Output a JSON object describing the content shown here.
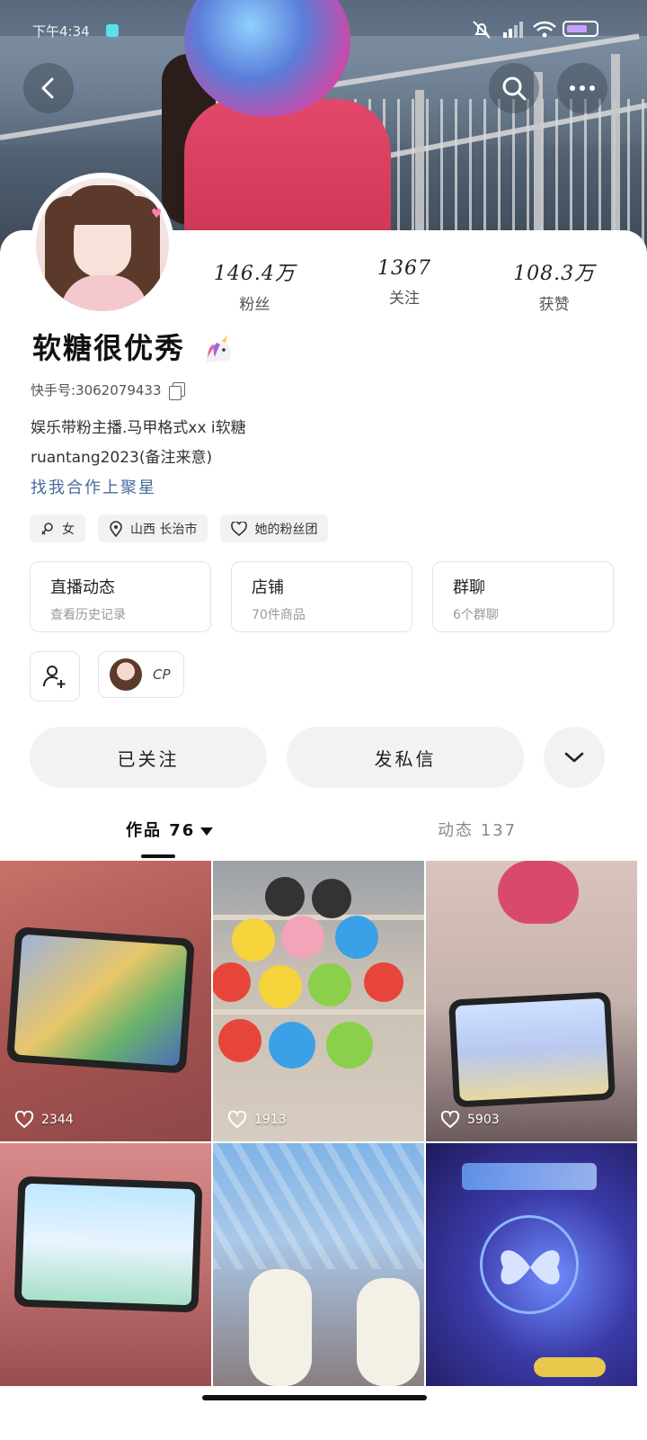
{
  "status_bar": {
    "time": "下午4:34"
  },
  "profile": {
    "stats": [
      {
        "value": "146.4万",
        "label": "粉丝"
      },
      {
        "value": "1367",
        "label": "关注"
      },
      {
        "value": "108.3万",
        "label": "获赞"
      }
    ],
    "nickname": "软糖很优秀",
    "user_id": "快手号:3062079433",
    "bio_line1": "娱乐带粉主播.马甲格式xx i软糖",
    "bio_line2": "ruantang2023(备注来意)",
    "collab_link": "找我合作上聚星",
    "tags": [
      {
        "icon": "female-icon",
        "label": "女"
      },
      {
        "icon": "location-pin-icon",
        "label": "山西 长治市"
      },
      {
        "icon": "heart-icon",
        "label": "她的粉丝团"
      }
    ],
    "entries": [
      {
        "title": "直播动态",
        "subtitle": "查看历史记录"
      },
      {
        "title": "店铺",
        "subtitle": "70件商品"
      },
      {
        "title": "群聊",
        "subtitle": "6个群聊"
      }
    ],
    "cp_label": "CP"
  },
  "actions": {
    "follow": "已关注",
    "message": "发私信"
  },
  "tabs": {
    "works": "作品 76",
    "moments": "动态 137"
  },
  "posts": [
    {
      "likes": "2344"
    },
    {
      "likes": "1913"
    },
    {
      "likes": "5903"
    },
    {
      "likes": ""
    },
    {
      "likes": ""
    },
    {
      "likes": ""
    }
  ]
}
